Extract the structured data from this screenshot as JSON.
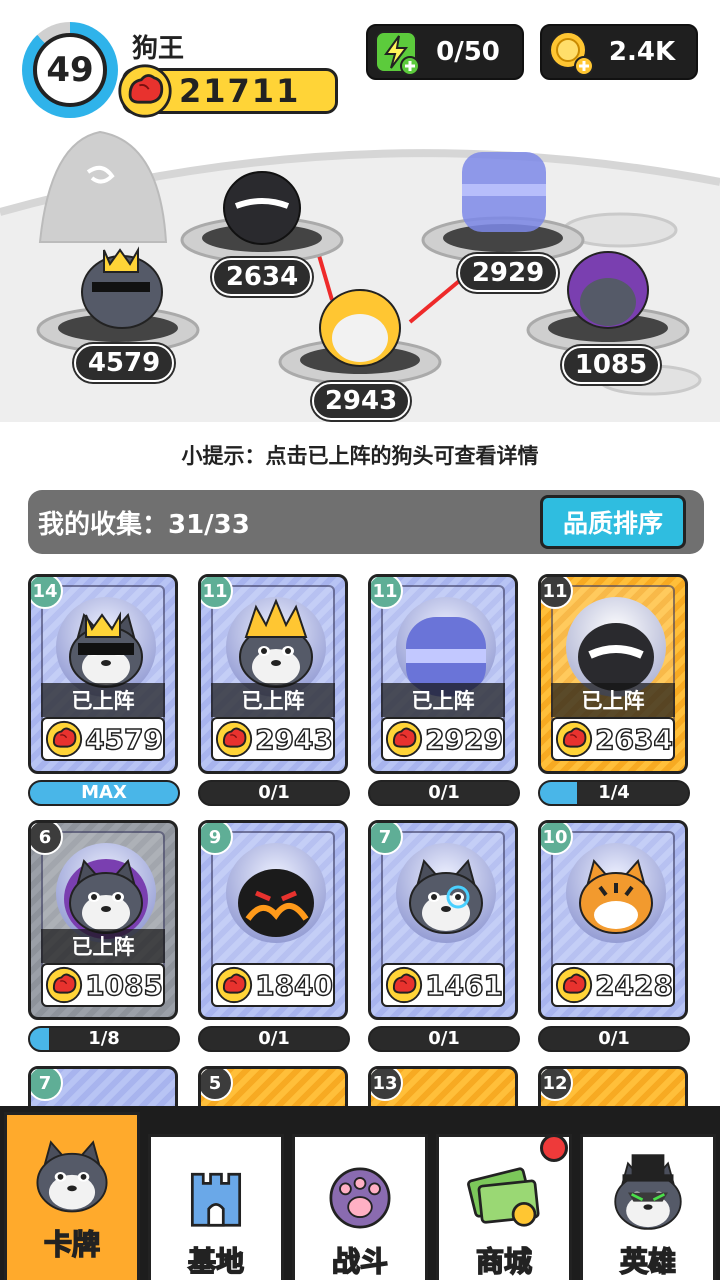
{
  "header": {
    "level": "49",
    "player_name": "狗王",
    "power": "21711",
    "energy": "0/50",
    "coins": "2.4K"
  },
  "arena": {
    "tags": [
      "2634",
      "2929",
      "4579",
      "1085",
      "2943"
    ]
  },
  "tip": "小提示：点击已上阵的狗头可查看详情",
  "collection": {
    "label": "我的收集：31/33",
    "sort_button": "品质排序"
  },
  "cards": [
    {
      "level": "14",
      "status": "已上阵",
      "power": "4579",
      "progress": "MAX",
      "fill": 1.0
    },
    {
      "level": "11",
      "status": "已上阵",
      "power": "2943",
      "progress": "0/1",
      "fill": 0
    },
    {
      "level": "11",
      "status": "已上阵",
      "power": "2929",
      "progress": "0/1",
      "fill": 0
    },
    {
      "level": "11",
      "status": "已上阵",
      "power": "2634",
      "progress": "1/4",
      "fill": 0.25
    },
    {
      "level": "6",
      "status": "已上阵",
      "power": "1085",
      "progress": "1/8",
      "fill": 0.125
    },
    {
      "level": "9",
      "status": "",
      "power": "1840",
      "progress": "0/1",
      "fill": 0
    },
    {
      "level": "7",
      "status": "",
      "power": "1461",
      "progress": "0/1",
      "fill": 0
    },
    {
      "level": "10",
      "status": "",
      "power": "2428",
      "progress": "0/1",
      "fill": 0
    },
    {
      "level": "7"
    },
    {
      "level": "5"
    },
    {
      "level": "13"
    },
    {
      "level": "12"
    }
  ],
  "nav": {
    "cards": "卡牌",
    "base": "基地",
    "battle": "战斗",
    "shop": "商城",
    "heroes": "英雄"
  },
  "colors": {
    "accent_orange": "#ffaa2c",
    "power_yellow": "#ffd437",
    "sort_blue": "#2fbde0",
    "progress_blue": "#49b6e8",
    "notify_red": "#ee3a3a"
  }
}
